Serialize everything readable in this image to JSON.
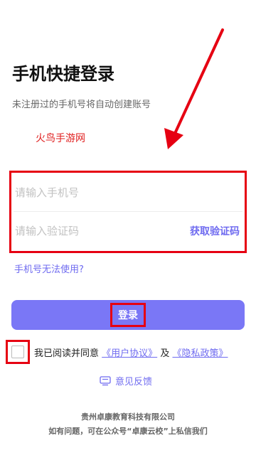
{
  "header": {
    "title": "手机快捷登录",
    "subtitle": "未注册过的手机号将自动创建账号"
  },
  "watermark": "火鸟手游网",
  "form": {
    "phone_placeholder": "请输入手机号",
    "code_placeholder": "请输入验证码",
    "get_code_label": "获取验证码",
    "phone_help": "手机号无法使用?"
  },
  "login_label": "登录",
  "agreement": {
    "prefix": "我已阅读并同意",
    "user_agreement": "《用户协议》",
    "and": "及",
    "privacy_policy": "《隐私政策》"
  },
  "feedback_label": "意见反馈",
  "footer": {
    "company": "贵州卓康教育科技有限公司",
    "contact": "如有问题，可在公众号“卓康云校”上私信我们"
  },
  "colors": {
    "accent": "#7a77f6",
    "link": "#6f6bf0",
    "annotation_red": "#e60012"
  }
}
